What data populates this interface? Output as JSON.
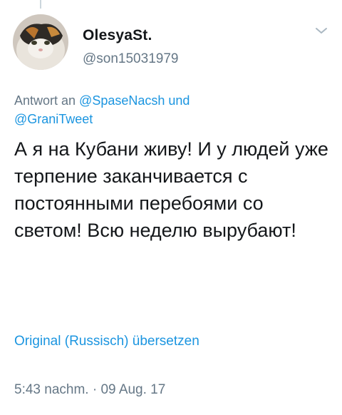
{
  "tweet": {
    "display_name": "OlesyaSt.",
    "handle": "@son15031979",
    "reply": {
      "prefix": "Antwort an ",
      "mention1": "@SpaseNacsh",
      "conjunction": " und",
      "mention2": "@GraniTweet"
    },
    "text": "А я на Кубани живу! И у людей уже терпение заканчивается с постоянными перебоями со светом! Всю неделю вырубают!",
    "translate_label": "Original (Russisch) übersetzen",
    "timestamp": "5:43 nachm. · 09 Aug. 17",
    "avatar_icon": "cat-avatar-icon",
    "menu_icon": "chevron-down-icon",
    "colors": {
      "link": "#1b95e0",
      "secondary_text": "#657786",
      "primary_text": "#14171a"
    }
  }
}
